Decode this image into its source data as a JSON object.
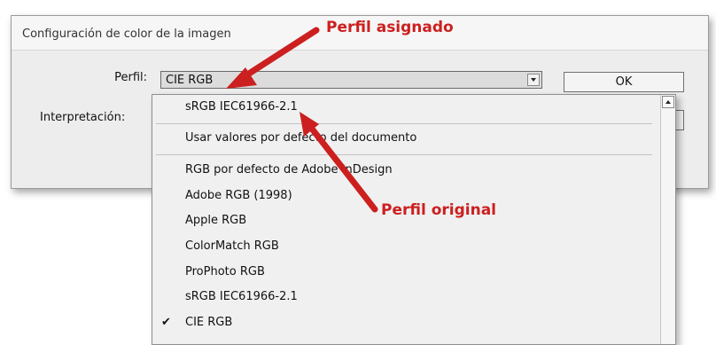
{
  "dialog": {
    "title": "Configuración de color de la imagen",
    "profile_label": "Perfil:",
    "profile_value": "CIE RGB",
    "interpretation_label": "Interpretación:",
    "ok_label": "OK"
  },
  "menu": {
    "items": [
      "sRGB IEC61966-2.1",
      "Usar valores por defecto del documento",
      "RGB por defecto de Adobe InDesign",
      "Adobe RGB (1998)",
      "Apple RGB",
      "ColorMatch RGB",
      "ProPhoto RGB",
      "sRGB IEC61966-2.1",
      "CIE RGB"
    ],
    "checked_item": "CIE RGB"
  },
  "annotations": {
    "assigned_profile": "Perfil asignado",
    "original_profile": "Perfil original"
  },
  "colors": {
    "annotation_red": "#cc1f1f"
  },
  "icons": [
    "chevron-down-icon",
    "scroll-up-icon",
    "check-icon",
    "arrow-icon"
  ]
}
